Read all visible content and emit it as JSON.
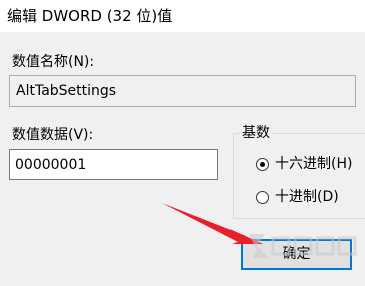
{
  "window": {
    "title": "编辑 DWORD (32 位)值"
  },
  "value_name": {
    "label": "数值名称(N):",
    "value": "AltTabSettings"
  },
  "value_data": {
    "label": "数值数据(V):",
    "value": "00000001"
  },
  "base": {
    "label": "基数",
    "options": [
      {
        "label": "十六进制(H)",
        "selected": true
      },
      {
        "label": "十进制(D)",
        "selected": false
      }
    ]
  },
  "buttons": {
    "ok": "确定"
  },
  "annotation_color": "#e8202a"
}
